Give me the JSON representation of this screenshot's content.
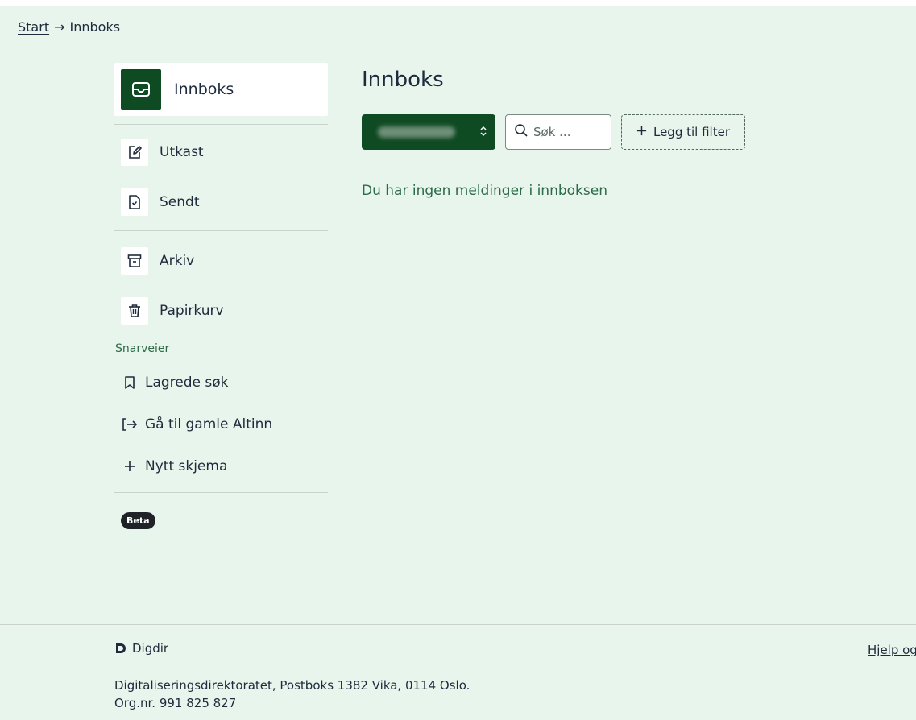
{
  "breadcrumb": {
    "home": "Start",
    "separator": "→",
    "current": "Innboks"
  },
  "sidebar": {
    "inbox_label": "Innboks",
    "items": [
      {
        "label": "Utkast",
        "icon": "edit-icon"
      },
      {
        "label": "Sendt",
        "icon": "sent-file-icon"
      },
      {
        "label": "Arkiv",
        "icon": "archive-icon"
      },
      {
        "label": "Papirkurv",
        "icon": "trash-icon"
      }
    ],
    "section_title": "Snarveier",
    "shortcuts": [
      {
        "label": "Lagrede søk",
        "icon": "bookmark-icon"
      },
      {
        "label": "Gå til gamle Altinn",
        "icon": "exit-icon"
      },
      {
        "label": "Nytt skjema",
        "icon": "plus-icon"
      }
    ],
    "badge": "Beta"
  },
  "main": {
    "title": "Innboks",
    "search_placeholder": "Søk ...",
    "filter_label": "Legg til filter",
    "empty_message": "Du har ingen meldinger i innboksen"
  },
  "footer": {
    "brand": "Digdir",
    "address": "Digitaliseringsdirektoratet, Postboks 1382 Vika, 0114 Oslo.",
    "org": "Org.nr. 991 825 827",
    "help_link": "Hjelp og"
  },
  "colors": {
    "brand_green": "#0e4a22",
    "page_bg": "#e8f5ec",
    "accent_text": "#2c6b47"
  }
}
